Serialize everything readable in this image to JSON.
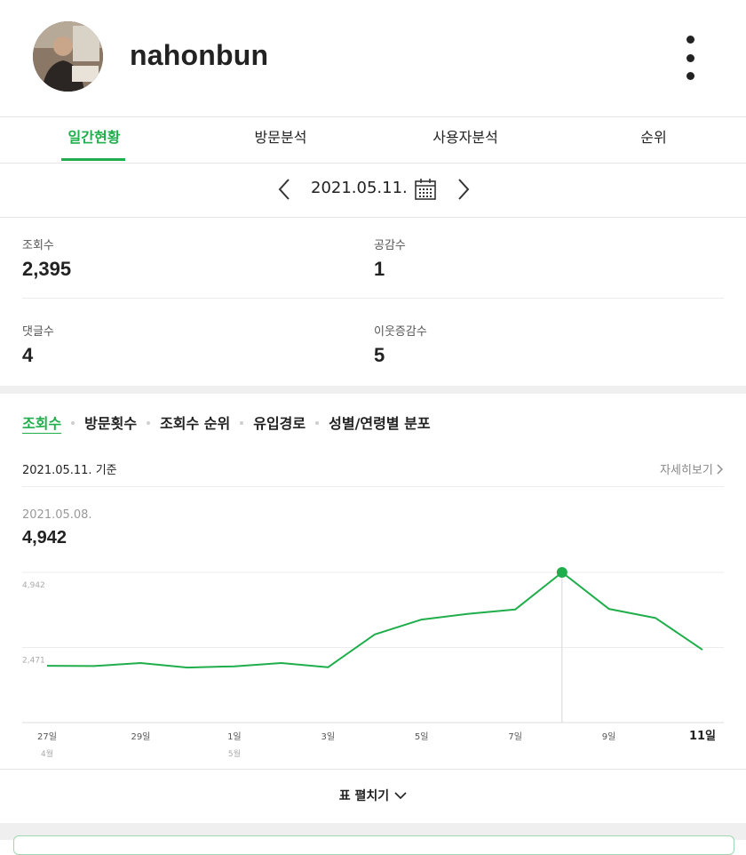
{
  "header": {
    "username": "nahonbun"
  },
  "tabs": [
    {
      "label": "일간현황",
      "active": true
    },
    {
      "label": "방문분석",
      "active": false
    },
    {
      "label": "사용자분석",
      "active": false
    },
    {
      "label": "순위",
      "active": false
    }
  ],
  "date_nav": {
    "date": "2021.05.11."
  },
  "stats": [
    {
      "label": "조회수",
      "value": "2,395"
    },
    {
      "label": "공감수",
      "value": "1"
    },
    {
      "label": "댓글수",
      "value": "4"
    },
    {
      "label": "이웃증감수",
      "value": "5"
    }
  ],
  "subtabs": [
    {
      "label": "조회수",
      "active": true
    },
    {
      "label": "방문횟수",
      "active": false
    },
    {
      "label": "조회수 순위",
      "active": false
    },
    {
      "label": "유입경로",
      "active": false
    },
    {
      "label": "성별/연령별 분포",
      "active": false
    }
  ],
  "chart_header": {
    "basis": "2021.05.11. 기준",
    "more_link": "자세히보기"
  },
  "selected_point": {
    "date": "2021.05.08.",
    "value": "4,942"
  },
  "chart_data": {
    "type": "line",
    "x": [
      "04-27",
      "04-28",
      "04-29",
      "04-30",
      "05-01",
      "05-02",
      "05-03",
      "05-04",
      "05-05",
      "05-06",
      "05-07",
      "05-08",
      "05-09",
      "05-10",
      "05-11"
    ],
    "values": [
      1870,
      1860,
      1960,
      1810,
      1850,
      1960,
      1820,
      2900,
      3390,
      3580,
      3720,
      4942,
      3740,
      3440,
      2395
    ],
    "ylim": [
      0,
      4942
    ],
    "y_ticks": [
      "4,942",
      "2,471"
    ],
    "x_ticks": [
      {
        "label": "27일",
        "sub": "4월",
        "index": 0,
        "bold": false
      },
      {
        "label": "29일",
        "sub": "",
        "index": 2,
        "bold": false
      },
      {
        "label": "1일",
        "sub": "5월",
        "index": 4,
        "bold": false
      },
      {
        "label": "3일",
        "sub": "",
        "index": 6,
        "bold": false
      },
      {
        "label": "5일",
        "sub": "",
        "index": 8,
        "bold": false
      },
      {
        "label": "7일",
        "sub": "",
        "index": 10,
        "bold": false
      },
      {
        "label": "9일",
        "sub": "",
        "index": 12,
        "bold": false
      },
      {
        "label": "11일",
        "sub": "",
        "index": 14,
        "bold": true
      }
    ],
    "highlight_index": 11,
    "line_color": "#1fae4b",
    "grid": true
  },
  "expand": {
    "label": "표 펼치기"
  },
  "colors": {
    "accent": "#1fae4b"
  }
}
